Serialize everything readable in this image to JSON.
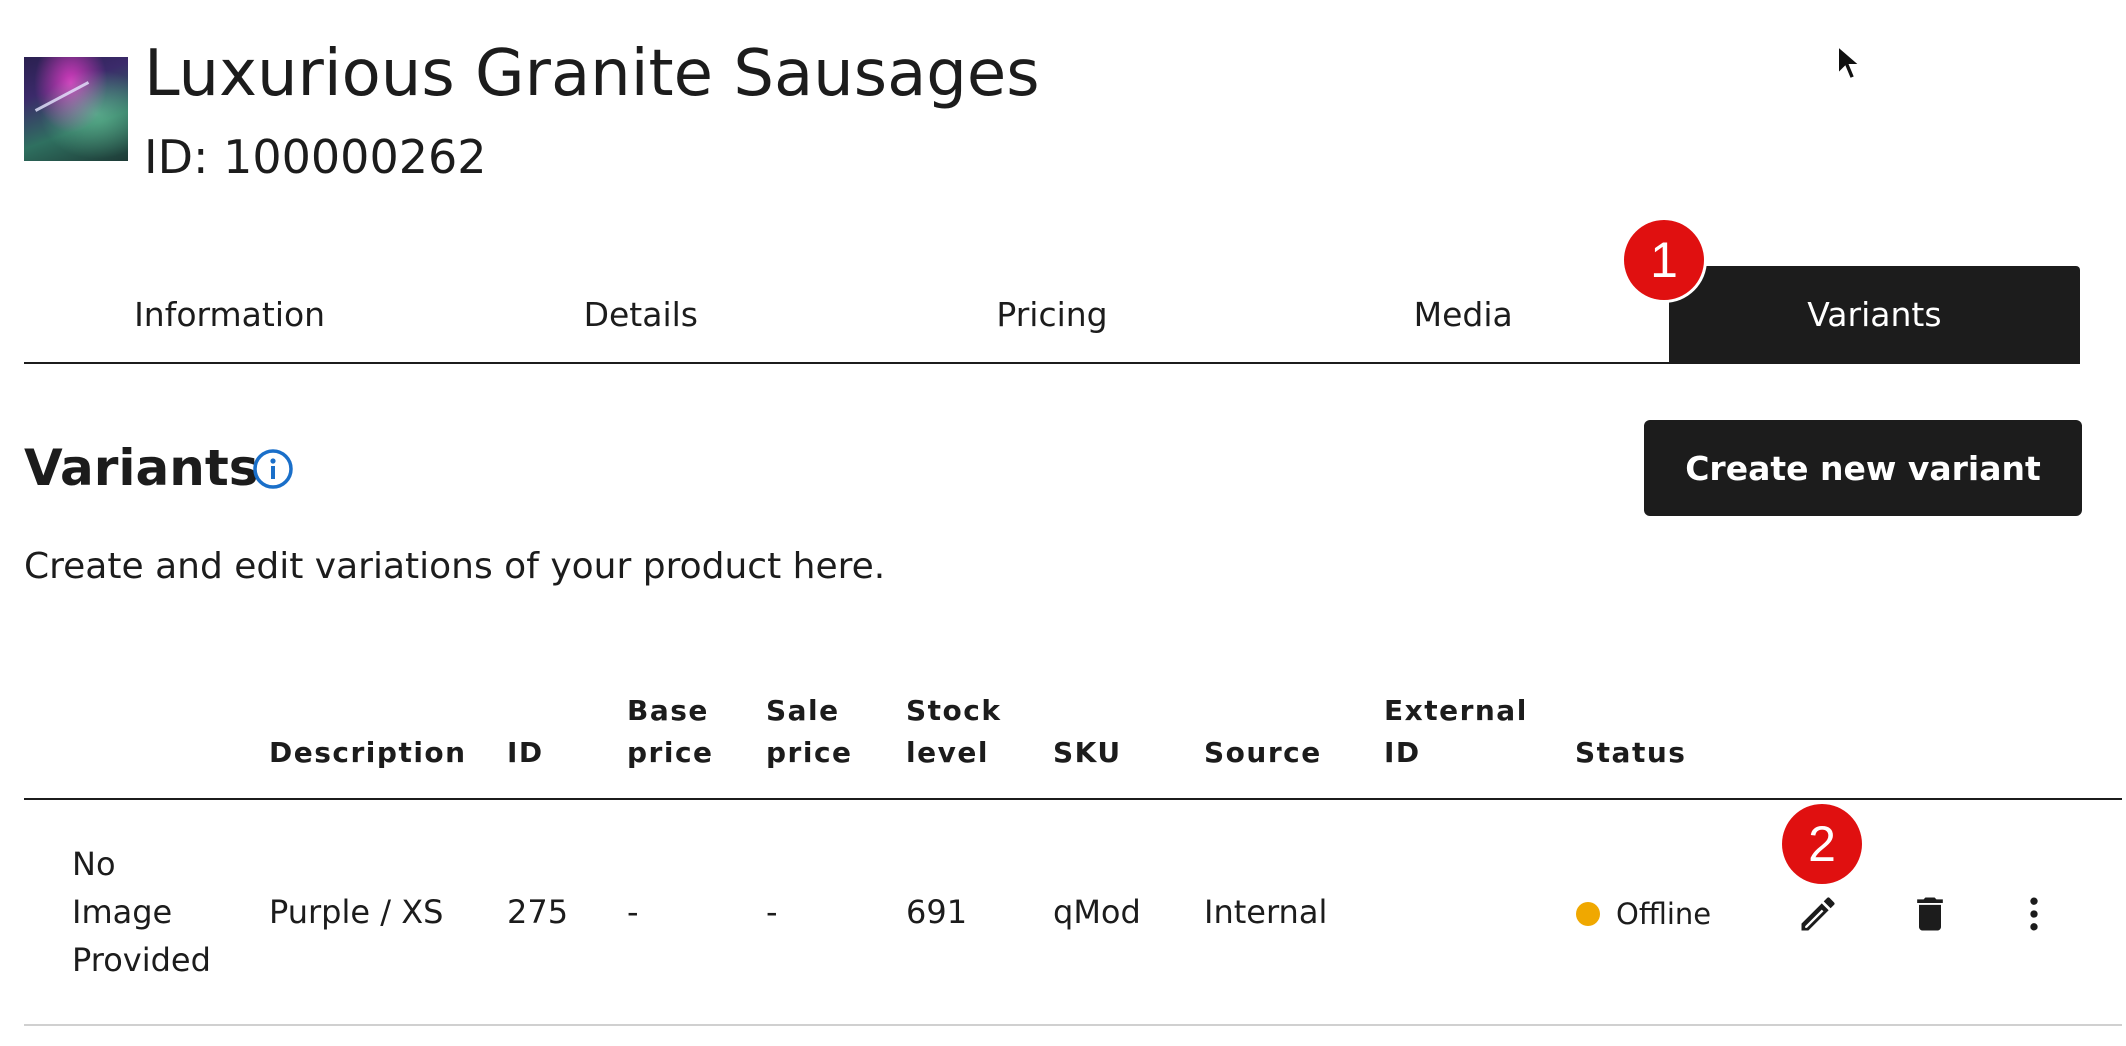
{
  "header": {
    "title": "Luxurious Granite Sausages",
    "id_label": "ID: 100000262"
  },
  "tabs": [
    {
      "label": "Information",
      "active": false
    },
    {
      "label": "Details",
      "active": false
    },
    {
      "label": "Pricing",
      "active": false
    },
    {
      "label": "Media",
      "active": false
    },
    {
      "label": "Variants",
      "active": true
    }
  ],
  "badges": {
    "one": "1",
    "two": "2"
  },
  "section": {
    "title": "Variants",
    "create_button": "Create new variant",
    "subtitle": "Create and edit variations of your product here."
  },
  "table": {
    "headers": {
      "description": "Description",
      "id": "ID",
      "base_price_1": "Base",
      "base_price_2": "price",
      "sale_price_1": "Sale",
      "sale_price_2": "price",
      "stock_1": "Stock",
      "stock_2": "level",
      "sku": "SKU",
      "source": "Source",
      "external_1": "External",
      "external_2": "ID",
      "status": "Status"
    },
    "rows": [
      {
        "image_1": "No",
        "image_2": "Image",
        "image_3": "Provided",
        "description": "Purple / XS",
        "id": "275",
        "base_price": "-",
        "sale_price": "-",
        "stock_level": "691",
        "sku": "qMod",
        "source": "Internal",
        "external_id": "",
        "status": "Offline"
      }
    ]
  },
  "colors": {
    "dark": "#1c1c1c",
    "badge_red": "#e01010",
    "info_blue": "#1a6fc9",
    "status_offline": "#f0a800"
  }
}
